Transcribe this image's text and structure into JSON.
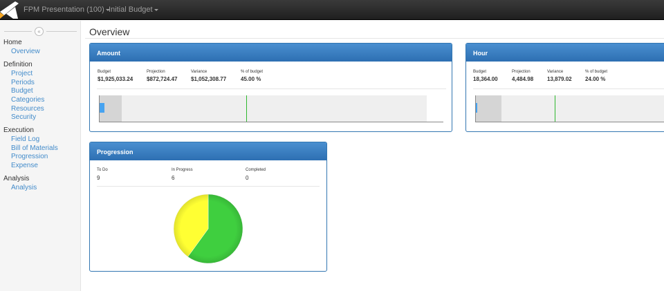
{
  "topbar": {
    "project_menu": "FPM Presentation (100)",
    "budget_menu": "Initial Budget"
  },
  "sidebar": {
    "collapse_glyph": "«",
    "groups": [
      {
        "label": "Home",
        "items": [
          {
            "label": "Overview"
          }
        ]
      },
      {
        "label": "Definition",
        "items": [
          {
            "label": "Project"
          },
          {
            "label": "Periods"
          },
          {
            "label": "Budget"
          },
          {
            "label": "Categories"
          },
          {
            "label": "Resources"
          },
          {
            "label": "Security"
          }
        ]
      },
      {
        "label": "Execution",
        "items": [
          {
            "label": "Field Log"
          },
          {
            "label": "Bill of Materials"
          },
          {
            "label": "Progression"
          },
          {
            "label": "Expense"
          }
        ]
      },
      {
        "label": "Analysis",
        "items": [
          {
            "label": "Analysis"
          }
        ]
      }
    ]
  },
  "main": {
    "title": "Overview"
  },
  "amount": {
    "title": "Amount",
    "stats": [
      {
        "label": "Budget",
        "value": "$1,925,033.24"
      },
      {
        "label": "Projection",
        "value": "$872,724.47"
      },
      {
        "label": "Variance",
        "value": "$1,052,308.77"
      },
      {
        "label": "% of budget",
        "value": "45.00 %"
      }
    ],
    "gauge": {
      "actual_fraction": 0.016,
      "projection_fraction": 0.07,
      "budget_fraction": 0.45
    }
  },
  "hour": {
    "title": "Hour",
    "stats": [
      {
        "label": "Budget",
        "value": "18,364.00"
      },
      {
        "label": "Projection",
        "value": "4,484.98"
      },
      {
        "label": "Variance",
        "value": "13,879.02"
      },
      {
        "label": "% of budget",
        "value": "24.00 %"
      }
    ],
    "gauge": {
      "actual_fraction": 0.006,
      "projection_fraction": 0.08,
      "budget_fraction": 0.24
    }
  },
  "progression": {
    "title": "Progression",
    "stats": [
      {
        "label": "To Do",
        "value": "9"
      },
      {
        "label": "In Progress",
        "value": "6"
      },
      {
        "label": "Completed",
        "value": "0"
      }
    ],
    "pie": [
      {
        "name": "To Do",
        "value": 9,
        "color": "#3fcf3f"
      },
      {
        "name": "In Progress",
        "value": 6,
        "color": "#ffff33"
      },
      {
        "name": "Completed",
        "value": 0,
        "color": "#999999"
      }
    ]
  },
  "colors": {
    "panel_header": "#337ab7",
    "link": "#428bca",
    "gauge_actual": "#47a3f0",
    "gauge_budget_marker": "#2eb82e"
  }
}
